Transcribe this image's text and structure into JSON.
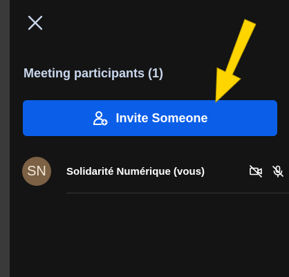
{
  "panel": {
    "title": "Meeting participants (1)",
    "close_icon": "close-icon",
    "invite_button": {
      "label": "Invite Someone",
      "icon": "add-person-icon"
    }
  },
  "participants": [
    {
      "initials": "SN",
      "name": "Solidarité Numérique (vous)",
      "avatar_color": "#7c6144",
      "camera": "off",
      "microphone": "off"
    }
  ],
  "colors": {
    "background": "#141414",
    "accent": "#0b5ee8",
    "title": "#c9d6ec",
    "annotation_arrow": "#ffd500"
  }
}
